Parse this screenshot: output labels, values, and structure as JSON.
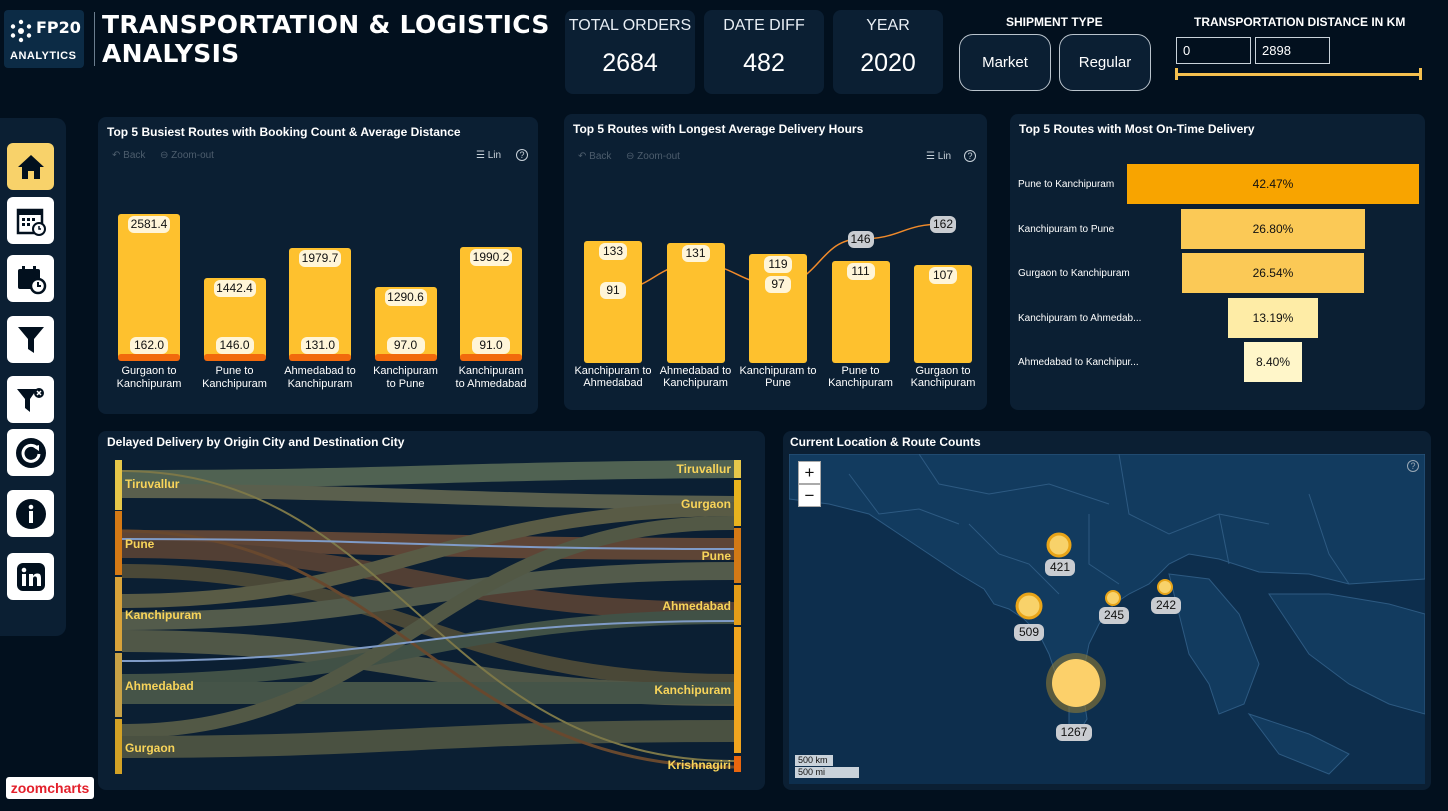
{
  "brand": {
    "name": "FP20",
    "sub": "ANALYTICS"
  },
  "title": {
    "line1": "TRANSPORTATION & LOGISTICS",
    "line2": "ANALYSIS"
  },
  "kpis": [
    {
      "label": "TOTAL ORDERS",
      "value": "2684"
    },
    {
      "label": "DATE DIFF",
      "value": "482"
    },
    {
      "label": "YEAR",
      "value": "2020"
    }
  ],
  "shipment": {
    "label": "SHIPMENT TYPE",
    "options": [
      "Market",
      "Regular"
    ]
  },
  "distance": {
    "label": "TRANSPORTATION DISTANCE IN KM",
    "min": "0",
    "max": "2898"
  },
  "sidebar": {
    "icons": [
      "home-icon",
      "calendar-clock-icon",
      "schedule-icon",
      "filter-icon",
      "clear-filter-icon",
      "refresh-icon",
      "info-icon",
      "linkedin-icon"
    ]
  },
  "toolbar": {
    "back": "Back",
    "zoom_out": "Zoom-out",
    "lin": "Lin",
    "help": "?"
  },
  "busiest": {
    "title": "Top 5 Busiest Routes with Booking Count & Average Distance",
    "routes": [
      {
        "l1": "Gurgaon to",
        "l2": "Kanchipuram",
        "distance": "2581.4",
        "count": "162.0"
      },
      {
        "l1": "Pune to",
        "l2": "Kanchipuram",
        "distance": "1442.4",
        "count": "146.0"
      },
      {
        "l1": "Ahmedabad to",
        "l2": "Kanchipuram",
        "distance": "1979.7",
        "count": "131.0"
      },
      {
        "l1": "Kanchipuram",
        "l2": "to Pune",
        "distance": "1290.6",
        "count": "97.0"
      },
      {
        "l1": "Kanchipuram",
        "l2": "to Ahmedabad",
        "distance": "1990.2",
        "count": "91.0"
      }
    ]
  },
  "longest": {
    "title": "Top 5 Routes with Longest Average Delivery Hours",
    "routes": [
      {
        "l1": "Kanchipuram to",
        "l2": "Ahmedabad",
        "hours": "133",
        "count": "91"
      },
      {
        "l1": "Ahmedabad to",
        "l2": "Kanchipuram",
        "hours": "131",
        "count": ""
      },
      {
        "l1": "Kanchipuram to",
        "l2": "Pune",
        "hours": "119",
        "count": "97"
      },
      {
        "l1": "Pune to",
        "l2": "Kanchipuram",
        "hours": "111",
        "count": "146"
      },
      {
        "l1": "Gurgaon to",
        "l2": "Kanchipuram",
        "hours": "107",
        "count": "162"
      }
    ]
  },
  "ontime": {
    "title": "Top 5 Routes with Most On-Time Delivery",
    "rows": [
      {
        "route": "Pune to Kanchipuram",
        "pct": "42.47%",
        "value": 42.47,
        "color": "#f8a400"
      },
      {
        "route": "Kanchipuram to Pune",
        "pct": "26.80%",
        "value": 26.8,
        "color": "#fbc956"
      },
      {
        "route": "Gurgaon to Kanchipuram",
        "pct": "26.54%",
        "value": 26.54,
        "color": "#fbc956"
      },
      {
        "route": "Kanchipuram to Ahmedab...",
        "pct": "13.19%",
        "value": 13.19,
        "color": "#feeca6"
      },
      {
        "route": "Ahmedabad to Kanchipur...",
        "pct": "8.40%",
        "value": 8.4,
        "color": "#fff6c9"
      }
    ]
  },
  "sankey": {
    "title": "Delayed Delivery by Origin City and Destination City",
    "origins": [
      "Tiruvallur",
      "Pune",
      "Kanchipuram",
      "Ahmedabad",
      "Gurgaon"
    ],
    "destinations": [
      "Tiruvallur",
      "Gurgaon",
      "Pune",
      "Ahmedabad",
      "Kanchipuram",
      "Krishnagiri"
    ]
  },
  "map": {
    "title": "Current Location & Route Counts",
    "zoom_in": "+",
    "zoom_out": "−",
    "bubbles": [
      "421",
      "245",
      "242",
      "509",
      "1267"
    ],
    "scale": [
      "500 km",
      "500 mi"
    ],
    "help": "?"
  },
  "footer": {
    "logo": "zoomcharts"
  }
}
